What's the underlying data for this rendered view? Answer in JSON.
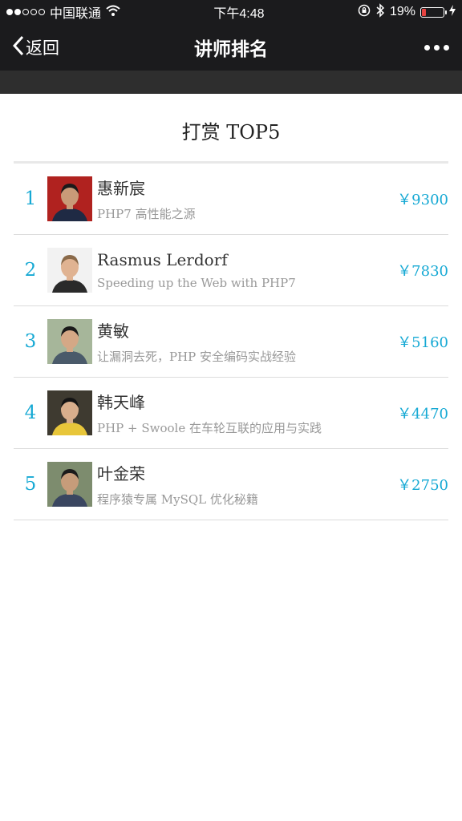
{
  "status_bar": {
    "carrier": "中国联通",
    "time": "下午4:48",
    "battery": "19%",
    "battery_level": 0.19
  },
  "nav": {
    "back_label": "返回",
    "title": "讲师排名"
  },
  "section": {
    "title": "打赏 TOP5"
  },
  "rankings": [
    {
      "rank": "1",
      "name": "惠新宸",
      "topic": "PHP7 高性能之源",
      "amount": "￥9300"
    },
    {
      "rank": "2",
      "name": "Rasmus Lerdorf",
      "topic": "Speeding up the Web with PHP7",
      "amount": "￥7830"
    },
    {
      "rank": "3",
      "name": "黄敏",
      "topic": "让漏洞去死，PHP 安全编码实战经验",
      "amount": "￥5160"
    },
    {
      "rank": "4",
      "name": "韩天峰",
      "topic": "PHP + Swoole 在车轮互联的应用与实践",
      "amount": "￥4470"
    },
    {
      "rank": "5",
      "name": "叶金荣",
      "topic": "程序猿专属 MySQL 优化秘籍",
      "amount": "￥2750"
    }
  ],
  "colors": {
    "accent": "#16a9d4",
    "nav_background": "#1b1b1d",
    "battery_low": "#e64340"
  }
}
